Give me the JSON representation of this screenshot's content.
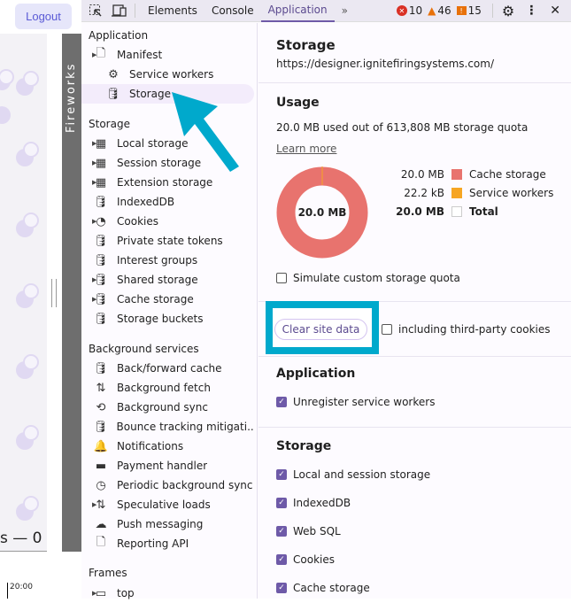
{
  "page": {
    "logout": "Logout",
    "counter_text": "s — 0",
    "time_label": "20:00",
    "side_label": "Fireworks"
  },
  "toolbar": {
    "tabs": [
      "Elements",
      "Console",
      "Application"
    ],
    "errors": "10",
    "warnings": "46",
    "issues": "15"
  },
  "sidebar": {
    "application_header": "Application",
    "application_items": [
      "Manifest",
      "Service workers",
      "Storage"
    ],
    "storage_header": "Storage",
    "storage_items": [
      "Local storage",
      "Session storage",
      "Extension storage",
      "IndexedDB",
      "Cookies",
      "Private state tokens",
      "Interest groups",
      "Shared storage",
      "Cache storage",
      "Storage buckets"
    ],
    "background_header": "Background services",
    "background_items": [
      "Back/forward cache",
      "Background fetch",
      "Background sync",
      "Bounce tracking mitigati...",
      "Notifications",
      "Payment handler",
      "Periodic background sync",
      "Speculative loads",
      "Push messaging",
      "Reporting API"
    ],
    "frames_header": "Frames",
    "frames_items": [
      "top"
    ]
  },
  "main": {
    "title": "Storage",
    "origin": "https://designer.ignitefiringsystems.com/",
    "usage_header": "Usage",
    "usage_text": "20.0 MB used out of 613,808 MB storage quota",
    "learn_more": "Learn more",
    "donut_label": "20.0 MB",
    "legend": [
      {
        "value": "20.0 MB",
        "label": "Cache storage",
        "color": "#e8736e"
      },
      {
        "value": "22.2 kB",
        "label": "Service workers",
        "color": "#f6a623"
      },
      {
        "value": "20.0 MB",
        "label": "Total",
        "color": "#ffffff"
      }
    ],
    "simulate": "Simulate custom storage quota",
    "clear_button": "Clear site data",
    "third_party": "including third-party cookies",
    "app_header": "Application",
    "unregister": "Unregister service workers",
    "storage_header": "Storage",
    "storage_checks": [
      "Local and session storage",
      "IndexedDB",
      "Web SQL",
      "Cookies",
      "Cache storage"
    ]
  },
  "colors": {
    "highlight": "#00a9cc",
    "accent": "#6e5aa8"
  }
}
